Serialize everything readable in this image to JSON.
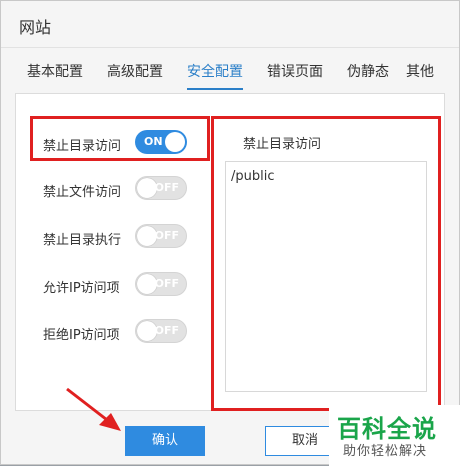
{
  "dialog": {
    "title": "网站"
  },
  "tabs": [
    {
      "label": "基本配置"
    },
    {
      "label": "高级配置"
    },
    {
      "label": "安全配置",
      "active": true
    },
    {
      "label": "错误页面"
    },
    {
      "label": "伪静态"
    },
    {
      "label": "其他"
    }
  ],
  "settings": [
    {
      "label": "禁止目录访问",
      "state": "ON",
      "enabled": true
    },
    {
      "label": "禁止文件访问",
      "state": "OFF",
      "enabled": false
    },
    {
      "label": "禁止目录执行",
      "state": "OFF",
      "enabled": false
    },
    {
      "label": "允许IP访问项",
      "state": "OFF",
      "enabled": false
    },
    {
      "label": "拒绝IP访问项",
      "state": "OFF",
      "enabled": false
    }
  ],
  "detail": {
    "label": "禁止目录访问",
    "value": "/public"
  },
  "buttons": {
    "ok": "确认",
    "cancel": "取消"
  },
  "watermark": {
    "main": "百科全说",
    "sub": "助你轻松解决"
  },
  "colors": {
    "accent": "#2f8be0",
    "highlight": "#e02020",
    "watermark": "#1aa54a"
  }
}
